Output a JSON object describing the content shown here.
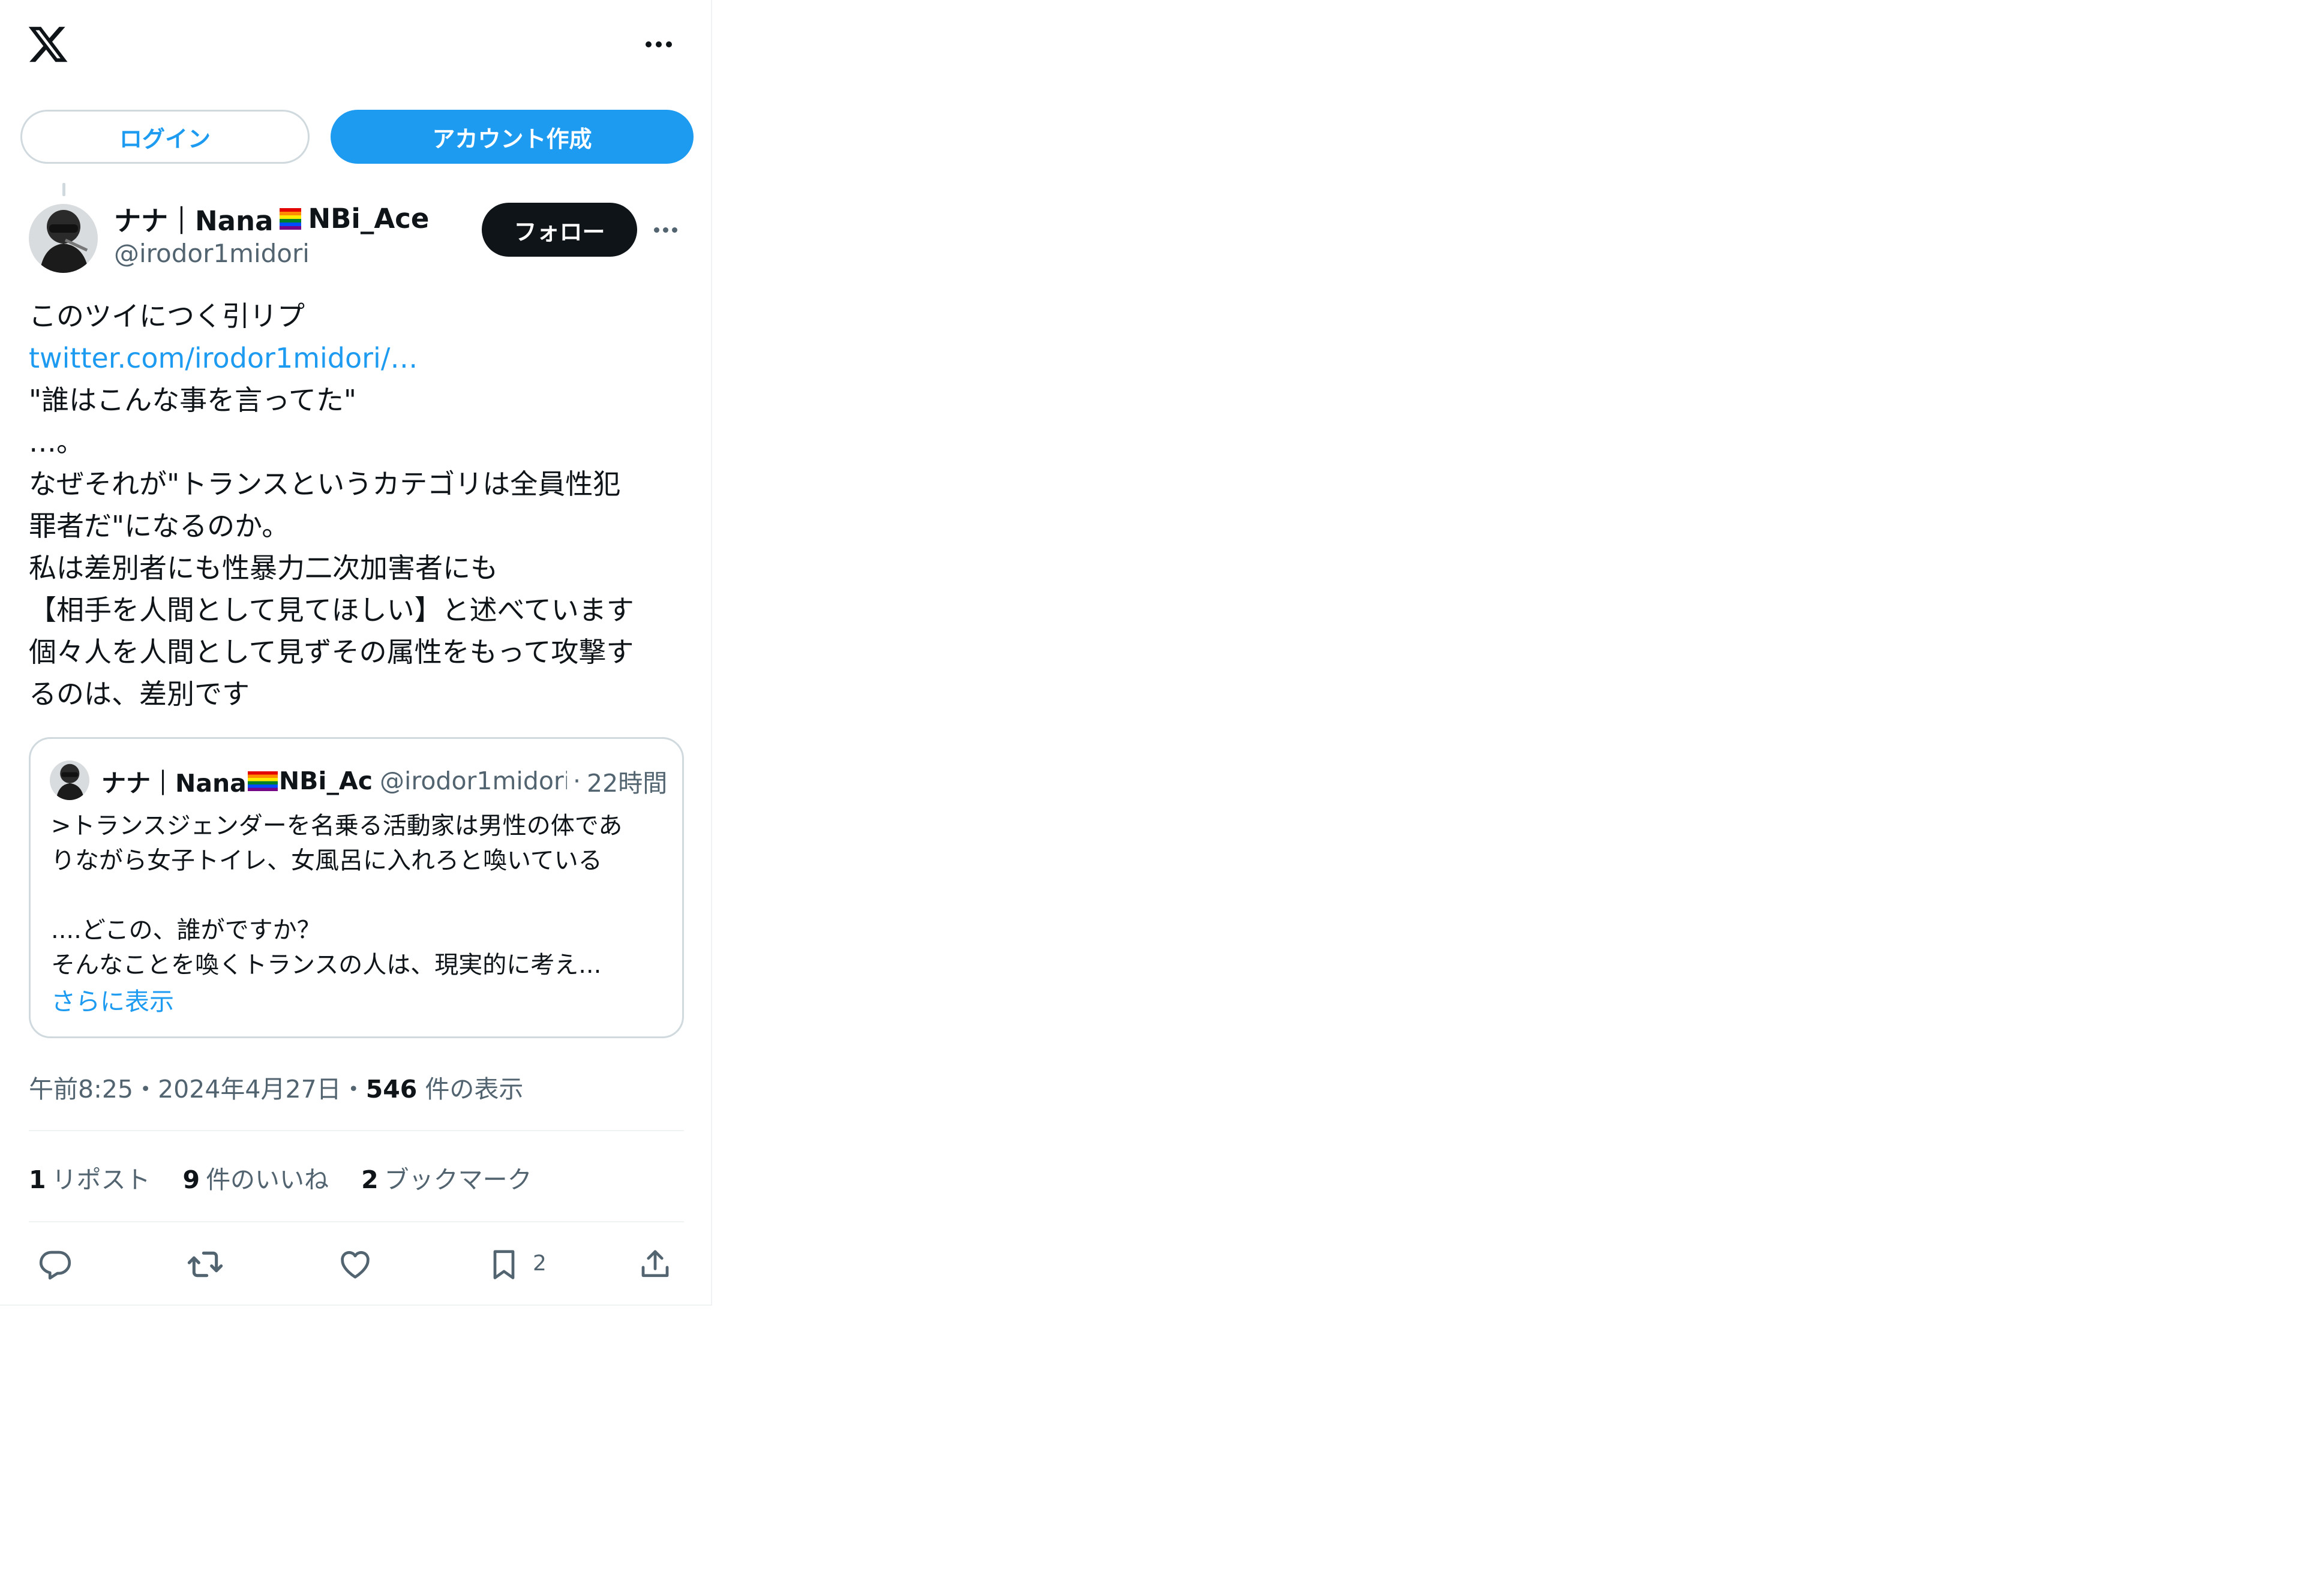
{
  "header": {
    "logo_icon": "x-logo-icon",
    "more_icon": "more-horizontal-icon"
  },
  "auth": {
    "login_label": "ログイン",
    "signup_label": "アカウント作成"
  },
  "author": {
    "name_prefix": "ナナ｜Nana",
    "name_suffix": "NBi_Ace",
    "handle": "@irodor1midori",
    "follow_label": "フォロー"
  },
  "tweet": {
    "line1": "このツイにつく引リプ",
    "link": "twitter.com/irodor1midori/…",
    "body": "\"誰はこんな事を言ってた\"\n…。\nなぜそれが\"トランスというカテゴリは全員性犯\n罪者だ\"になるのか。\n私は差別者にも性暴力二次加害者にも\n【相手を人間として見てほしい】と述べています\n個々人を人間として見ずその属性をもって攻撃す\nるのは、差別です"
  },
  "quote": {
    "name_prefix": "ナナ｜Nana",
    "name_suffix": "NBi_Ac",
    "handle": "@irodor1midori",
    "separator": "·",
    "time": "22時間",
    "text": ">トランスジェンダーを名乗る活動家は男性の体であ\nりながら女子トイレ、女風呂に入れろと喚いている\n\n....どこの、誰がですか？\nそんなことを喚くトランスの人は、現実的に考え...",
    "show_more": "さらに表示"
  },
  "meta": {
    "time": "午前8:25",
    "dot1": "・",
    "date": "2024年4月27日",
    "dot2": "・",
    "views": "546",
    "views_label": " 件の表示"
  },
  "stats": {
    "reposts": "1",
    "reposts_label": "リポスト",
    "likes": "9",
    "likes_label": "件のいいね",
    "bookmarks": "2",
    "bookmarks_label": "ブックマーク"
  },
  "actions": {
    "bookmark_count": "2"
  },
  "colors": {
    "accent": "#1d9bf0",
    "text": "#0f1419",
    "secondary": "#536471",
    "border": "#cfd9de"
  }
}
